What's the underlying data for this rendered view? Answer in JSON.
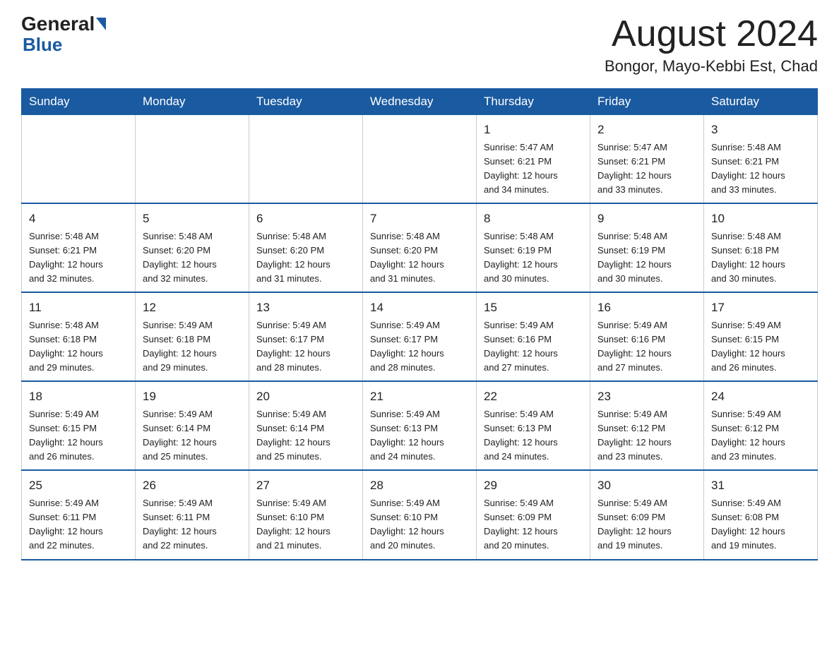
{
  "logo": {
    "general": "General",
    "blue": "Blue"
  },
  "header": {
    "title": "August 2024",
    "subtitle": "Bongor, Mayo-Kebbi Est, Chad"
  },
  "days_of_week": [
    "Sunday",
    "Monday",
    "Tuesday",
    "Wednesday",
    "Thursday",
    "Friday",
    "Saturday"
  ],
  "weeks": [
    [
      {
        "num": "",
        "info": ""
      },
      {
        "num": "",
        "info": ""
      },
      {
        "num": "",
        "info": ""
      },
      {
        "num": "",
        "info": ""
      },
      {
        "num": "1",
        "info": "Sunrise: 5:47 AM\nSunset: 6:21 PM\nDaylight: 12 hours\nand 34 minutes."
      },
      {
        "num": "2",
        "info": "Sunrise: 5:47 AM\nSunset: 6:21 PM\nDaylight: 12 hours\nand 33 minutes."
      },
      {
        "num": "3",
        "info": "Sunrise: 5:48 AM\nSunset: 6:21 PM\nDaylight: 12 hours\nand 33 minutes."
      }
    ],
    [
      {
        "num": "4",
        "info": "Sunrise: 5:48 AM\nSunset: 6:21 PM\nDaylight: 12 hours\nand 32 minutes."
      },
      {
        "num": "5",
        "info": "Sunrise: 5:48 AM\nSunset: 6:20 PM\nDaylight: 12 hours\nand 32 minutes."
      },
      {
        "num": "6",
        "info": "Sunrise: 5:48 AM\nSunset: 6:20 PM\nDaylight: 12 hours\nand 31 minutes."
      },
      {
        "num": "7",
        "info": "Sunrise: 5:48 AM\nSunset: 6:20 PM\nDaylight: 12 hours\nand 31 minutes."
      },
      {
        "num": "8",
        "info": "Sunrise: 5:48 AM\nSunset: 6:19 PM\nDaylight: 12 hours\nand 30 minutes."
      },
      {
        "num": "9",
        "info": "Sunrise: 5:48 AM\nSunset: 6:19 PM\nDaylight: 12 hours\nand 30 minutes."
      },
      {
        "num": "10",
        "info": "Sunrise: 5:48 AM\nSunset: 6:18 PM\nDaylight: 12 hours\nand 30 minutes."
      }
    ],
    [
      {
        "num": "11",
        "info": "Sunrise: 5:48 AM\nSunset: 6:18 PM\nDaylight: 12 hours\nand 29 minutes."
      },
      {
        "num": "12",
        "info": "Sunrise: 5:49 AM\nSunset: 6:18 PM\nDaylight: 12 hours\nand 29 minutes."
      },
      {
        "num": "13",
        "info": "Sunrise: 5:49 AM\nSunset: 6:17 PM\nDaylight: 12 hours\nand 28 minutes."
      },
      {
        "num": "14",
        "info": "Sunrise: 5:49 AM\nSunset: 6:17 PM\nDaylight: 12 hours\nand 28 minutes."
      },
      {
        "num": "15",
        "info": "Sunrise: 5:49 AM\nSunset: 6:16 PM\nDaylight: 12 hours\nand 27 minutes."
      },
      {
        "num": "16",
        "info": "Sunrise: 5:49 AM\nSunset: 6:16 PM\nDaylight: 12 hours\nand 27 minutes."
      },
      {
        "num": "17",
        "info": "Sunrise: 5:49 AM\nSunset: 6:15 PM\nDaylight: 12 hours\nand 26 minutes."
      }
    ],
    [
      {
        "num": "18",
        "info": "Sunrise: 5:49 AM\nSunset: 6:15 PM\nDaylight: 12 hours\nand 26 minutes."
      },
      {
        "num": "19",
        "info": "Sunrise: 5:49 AM\nSunset: 6:14 PM\nDaylight: 12 hours\nand 25 minutes."
      },
      {
        "num": "20",
        "info": "Sunrise: 5:49 AM\nSunset: 6:14 PM\nDaylight: 12 hours\nand 25 minutes."
      },
      {
        "num": "21",
        "info": "Sunrise: 5:49 AM\nSunset: 6:13 PM\nDaylight: 12 hours\nand 24 minutes."
      },
      {
        "num": "22",
        "info": "Sunrise: 5:49 AM\nSunset: 6:13 PM\nDaylight: 12 hours\nand 24 minutes."
      },
      {
        "num": "23",
        "info": "Sunrise: 5:49 AM\nSunset: 6:12 PM\nDaylight: 12 hours\nand 23 minutes."
      },
      {
        "num": "24",
        "info": "Sunrise: 5:49 AM\nSunset: 6:12 PM\nDaylight: 12 hours\nand 23 minutes."
      }
    ],
    [
      {
        "num": "25",
        "info": "Sunrise: 5:49 AM\nSunset: 6:11 PM\nDaylight: 12 hours\nand 22 minutes."
      },
      {
        "num": "26",
        "info": "Sunrise: 5:49 AM\nSunset: 6:11 PM\nDaylight: 12 hours\nand 22 minutes."
      },
      {
        "num": "27",
        "info": "Sunrise: 5:49 AM\nSunset: 6:10 PM\nDaylight: 12 hours\nand 21 minutes."
      },
      {
        "num": "28",
        "info": "Sunrise: 5:49 AM\nSunset: 6:10 PM\nDaylight: 12 hours\nand 20 minutes."
      },
      {
        "num": "29",
        "info": "Sunrise: 5:49 AM\nSunset: 6:09 PM\nDaylight: 12 hours\nand 20 minutes."
      },
      {
        "num": "30",
        "info": "Sunrise: 5:49 AM\nSunset: 6:09 PM\nDaylight: 12 hours\nand 19 minutes."
      },
      {
        "num": "31",
        "info": "Sunrise: 5:49 AM\nSunset: 6:08 PM\nDaylight: 12 hours\nand 19 minutes."
      }
    ]
  ]
}
